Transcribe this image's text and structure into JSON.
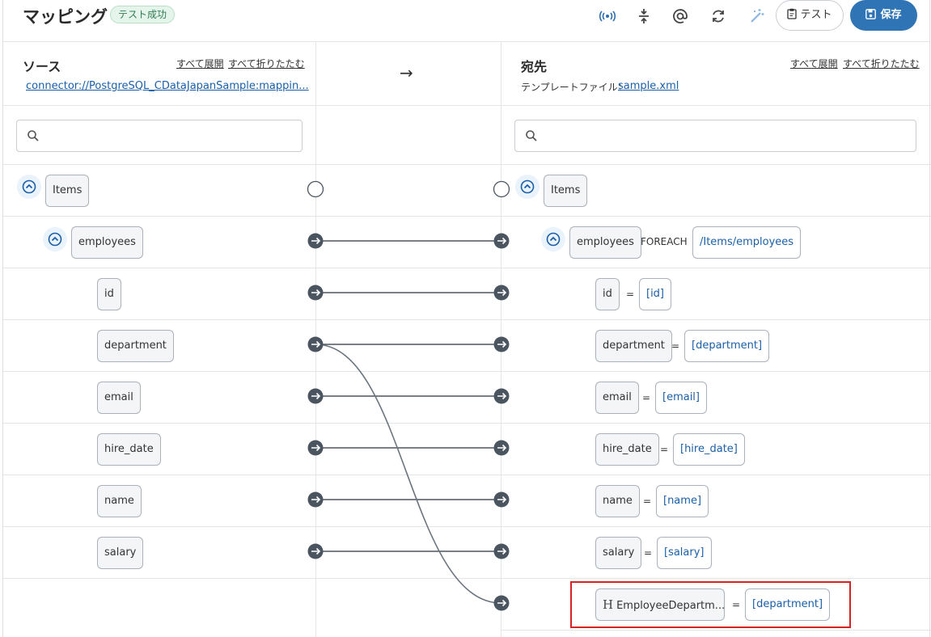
{
  "header": {
    "title": "マッピング",
    "status_badge": "テスト成功",
    "test_label": "テスト",
    "save_label": "保存"
  },
  "source": {
    "title": "ソース",
    "expand_all": "すべて展開",
    "collapse_all": "すべて折りたたむ",
    "connector_link": "connector://PostgreSQL_CDataJapanSample:mappin...",
    "search_placeholder": "",
    "root": "Items",
    "group": "employees",
    "fields": [
      "id",
      "department",
      "email",
      "hire_date",
      "name",
      "salary"
    ]
  },
  "destination": {
    "title": "宛先",
    "expand_all": "すべて展開",
    "collapse_all": "すべて折りたたむ",
    "template_label": "テンプレートファイル：",
    "template_file": "sample.xml",
    "search_placeholder": "",
    "root": "Items",
    "group": "employees",
    "foreach_keyword": "FOREACH",
    "foreach_path": "/Items/employees",
    "equals": "=",
    "fields": [
      {
        "name": "id",
        "value": "[id]"
      },
      {
        "name": "department",
        "value": "[department]"
      },
      {
        "name": "email",
        "value": "[email]"
      },
      {
        "name": "hire_date",
        "value": "[hire_date]"
      },
      {
        "name": "name",
        "value": "[name]"
      },
      {
        "name": "salary",
        "value": "[salary]"
      },
      {
        "name": "EmployeeDepartm...",
        "value": "[department]",
        "prefix": "H"
      }
    ]
  },
  "middle": {
    "arrow": "→"
  },
  "colors": {
    "accent": "#2f74b5",
    "link": "#1a5fa8",
    "connector": "#4a5560",
    "highlight": "#d42323",
    "success": "#2e7d4f"
  }
}
